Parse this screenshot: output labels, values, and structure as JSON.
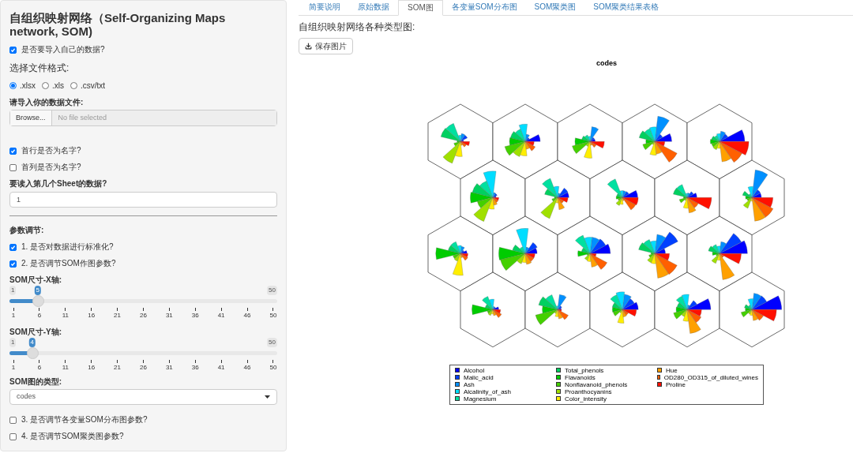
{
  "sidebar": {
    "title": "自组织映射网络（Self-Organizing Maps network, SOM)",
    "import_own_data": {
      "label": "是否要导入自己的数据?",
      "checked": true
    },
    "file_format": {
      "label": "选择文件格式:",
      "options": [
        {
          "label": ".xlsx",
          "selected": true
        },
        {
          "label": ".xls",
          "selected": false
        },
        {
          "label": ".csv/txt",
          "selected": false
        }
      ]
    },
    "file_input": {
      "label": "请导入你的数据文件:",
      "button": "Browse...",
      "placeholder": "No file selected"
    },
    "header_checks": [
      {
        "label": "首行是否为名字?",
        "checked": true
      },
      {
        "label": "首列是否为名字?",
        "checked": false
      }
    ],
    "sheet": {
      "label": "要读入第几个Sheet的数据?",
      "value": "1"
    },
    "params_heading": "参数调节:",
    "param_checks": [
      {
        "label": "1. 是否对数据进行标准化?",
        "checked": true
      },
      {
        "label": "2. 是否调节SOM作图参数?",
        "checked": true
      }
    ],
    "sliders": [
      {
        "label": "SOM尺寸-X轴:",
        "min": "1",
        "max": "50",
        "value": "5",
        "level": 0.082,
        "ticks": [
          "1",
          "6",
          "11",
          "16",
          "21",
          "26",
          "31",
          "36",
          "41",
          "46",
          "50"
        ]
      },
      {
        "label": "SOM尺寸-Y轴:",
        "min": "1",
        "max": "50",
        "value": "4",
        "level": 0.061,
        "ticks": [
          "1",
          "6",
          "11",
          "16",
          "21",
          "26",
          "31",
          "36",
          "41",
          "46",
          "50"
        ]
      }
    ],
    "plot_type": {
      "label": "SOM图的类型:",
      "value": "codes"
    },
    "more_checks": [
      {
        "label": "3. 是否调节各变量SOM分布图参数?",
        "checked": false
      },
      {
        "label": "4. 是否调节SOM聚类图参数?",
        "checked": false
      }
    ]
  },
  "tabs": [
    {
      "label": "简要说明",
      "selected": false
    },
    {
      "label": "原始数据",
      "selected": false
    },
    {
      "label": "SOM图",
      "selected": true
    },
    {
      "label": "各变量SOM分布图",
      "selected": false
    },
    {
      "label": "SOM聚类图",
      "selected": false
    },
    {
      "label": "SOM聚类结果表格",
      "selected": false
    }
  ],
  "main": {
    "heading": "自组织映射网络各种类型图:",
    "save_button": "保存图片",
    "plot_title": "codes",
    "legend": [
      {
        "label": "Alcohol",
        "color": "#0000ff"
      },
      {
        "label": "Malic_acid",
        "color": "#0040ff"
      },
      {
        "label": "Ash",
        "color": "#0090ff"
      },
      {
        "label": "Alcalinity_of_ash",
        "color": "#00ddff"
      },
      {
        "label": "Magnesium",
        "color": "#00e0a0"
      },
      {
        "label": "Total_phenols",
        "color": "#00d060"
      },
      {
        "label": "Flavanoids",
        "color": "#00cc00"
      },
      {
        "label": "Nonflavanoid_phenols",
        "color": "#44d000"
      },
      {
        "label": "Proanthocyanins",
        "color": "#a0e000"
      },
      {
        "label": "Color_intensity",
        "color": "#ffee00"
      },
      {
        "label": "Hue",
        "color": "#ffa000"
      },
      {
        "label": "OD280_OD315_of_diluted_wines",
        "color": "#ff6000"
      },
      {
        "label": "Proline",
        "color": "#ff1000"
      }
    ]
  }
}
